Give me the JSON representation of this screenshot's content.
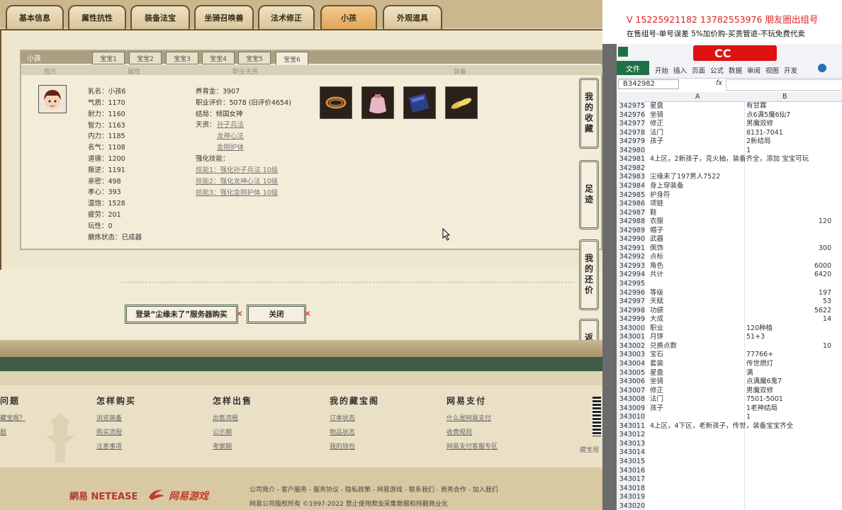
{
  "main_tabs": [
    "基本信息",
    "属性抗性",
    "装备法宝",
    "坐骑召唤兽",
    "法术修正",
    "小孩",
    "外观道具"
  ],
  "child_panel": {
    "title": "小孩",
    "bao_tabs": [
      "宝宝1",
      "宝宝2",
      "宝宝3",
      "宝宝4",
      "宝宝5",
      "宝宝6"
    ],
    "col_headers": [
      "图片",
      "属性",
      "职业天资",
      "装备"
    ],
    "attributes": [
      "乳名：小孩6",
      "气质：1170",
      "耐力：1160",
      "智力：1163",
      "内力：1185",
      "名气：1108",
      "道德：1200",
      "叛逆：1191",
      "亲密：498",
      "孝心：393",
      "温饱：1528",
      "疲劳：201",
      "玩性：0",
      "磨炼状态：已成器"
    ],
    "career": {
      "yangyu": "养育金：3907",
      "pingjia": "职业评价：5078 (旧评价4654)",
      "jieju": "结局：倾国女神",
      "tianzi_label": "天资：",
      "tianzi": [
        "孙子兵法",
        "龙神心法",
        "金刚护体"
      ],
      "skill_label": "强化技能：",
      "skills": [
        "技能1：强化孙子兵法 10级",
        "技能2：强化龙神心法 10级",
        "技能3：强化金刚护体 10级"
      ]
    }
  },
  "side_buttons": [
    "我的收藏",
    "足迹",
    "我的还价",
    "返回顶部"
  ],
  "action_buttons": {
    "login": "登录“尘缘未了”服务器购买",
    "close": "关闭"
  },
  "footer": {
    "headings": [
      "问题",
      "怎样购买",
      "怎样出售",
      "我的藏宝阁",
      "网易支付"
    ],
    "links": [
      [
        "藏宝阁？",
        "题"
      ],
      [
        "浏览装备",
        "购买流程",
        "注意事项"
      ],
      [
        "出售流程",
        "公示期",
        "考察期"
      ],
      [
        "订单状态",
        "物品状态",
        "我的钱包"
      ],
      [
        "什么是网易支付",
        "收费规则",
        "网易支付客服专区"
      ]
    ],
    "brand1": "網易 NETEASE",
    "brand2": "网易游戏",
    "bottom_links": "公司简介 - 客户服务 - 服务协议 - 隐私政策 - 网易游戏 - 联系我们 - 商务合作 - 加入我们",
    "copyright": "网易公司版权所有 ©1997-2022 禁止使用爬虫采集数据和持戳商业化",
    "qr_label": "藏宝阁"
  },
  "excel": {
    "banner1": "V 15225921182  13782553976 朋友圈出组号",
    "banner2": "在售组号-单号误差 5%加价购-买贵管退-不玩免费代卖",
    "menu": [
      "文件",
      "开始",
      "插入",
      "页面",
      "公式",
      "数据",
      "审阅",
      "视图",
      "开发"
    ],
    "name_box": "B342982",
    "fx": "fx",
    "col_a": "A",
    "col_b": "B",
    "rows": [
      [
        "342975",
        "星盘",
        "有甘霖",
        ""
      ],
      [
        "342976",
        "坐骑",
        "点6满5魔6仙7",
        ""
      ],
      [
        "342977",
        "修正",
        "男魔双修",
        ""
      ],
      [
        "342978",
        "法门",
        "8131-7041",
        ""
      ],
      [
        "342979",
        "孩子",
        "2新结局",
        ""
      ],
      [
        "342980",
        "",
        "1",
        ""
      ],
      [
        "342981",
        "4上区，2新孩子，克火抽，装备齐全，添加 宝宝可玩",
        "",
        ""
      ],
      [
        "342982",
        "",
        "",
        ""
      ],
      [
        "342983",
        "尘缘未了197男人7522",
        "",
        ""
      ],
      [
        "342984",
        "身上穿装备",
        "",
        ""
      ],
      [
        "342985",
        "护身符",
        "",
        ""
      ],
      [
        "342986",
        "项链",
        "",
        ""
      ],
      [
        "342987",
        "鞋",
        "",
        ""
      ],
      [
        "342988",
        "衣服",
        "",
        "120"
      ],
      [
        "342989",
        "帽子",
        "",
        ""
      ],
      [
        "342990",
        "武器",
        "",
        ""
      ],
      [
        "342991",
        "佩饰",
        "",
        "300"
      ],
      [
        "342992",
        "点标",
        "",
        ""
      ],
      [
        "342993",
        "角色",
        "",
        "6000"
      ],
      [
        "342994",
        "共计",
        "",
        "6420"
      ],
      [
        "342995",
        "",
        "",
        ""
      ],
      [
        "342996",
        "等级",
        "",
        "197"
      ],
      [
        "342997",
        "天赋",
        "",
        "53"
      ],
      [
        "342998",
        "功绩",
        "",
        "5622"
      ],
      [
        "342999",
        "大成",
        "",
        "14"
      ],
      [
        "343000",
        "职业",
        "120种植",
        ""
      ],
      [
        "343001",
        "月饼",
        "51+3",
        ""
      ],
      [
        "343002",
        "兑换点数",
        "",
        "10"
      ],
      [
        "343003",
        "宝石",
        "77766+",
        ""
      ],
      [
        "343004",
        "套装",
        "传世燃灯",
        ""
      ],
      [
        "343005",
        "星盘",
        "满",
        ""
      ],
      [
        "343006",
        "坐骑",
        "点满魔6鬼7",
        ""
      ],
      [
        "343007",
        "修正",
        "男魔双修",
        ""
      ],
      [
        "343008",
        "法门",
        "7501-5001",
        ""
      ],
      [
        "343009",
        "孩子",
        "1老神结局",
        ""
      ],
      [
        "343010",
        "",
        "1",
        ""
      ],
      [
        "343011",
        "4上区，4下区，老新孩子，传世，装备宝宝齐全",
        "",
        ""
      ],
      [
        "343012",
        "",
        "",
        ""
      ],
      [
        "343013",
        "",
        "",
        ""
      ],
      [
        "343014",
        "",
        "",
        ""
      ],
      [
        "343015",
        "",
        "",
        ""
      ],
      [
        "343016",
        "",
        "",
        ""
      ],
      [
        "343017",
        "",
        "",
        ""
      ],
      [
        "343018",
        "",
        "",
        ""
      ],
      [
        "343019",
        "",
        "",
        ""
      ],
      [
        "343020",
        "",
        "",
        ""
      ]
    ]
  }
}
